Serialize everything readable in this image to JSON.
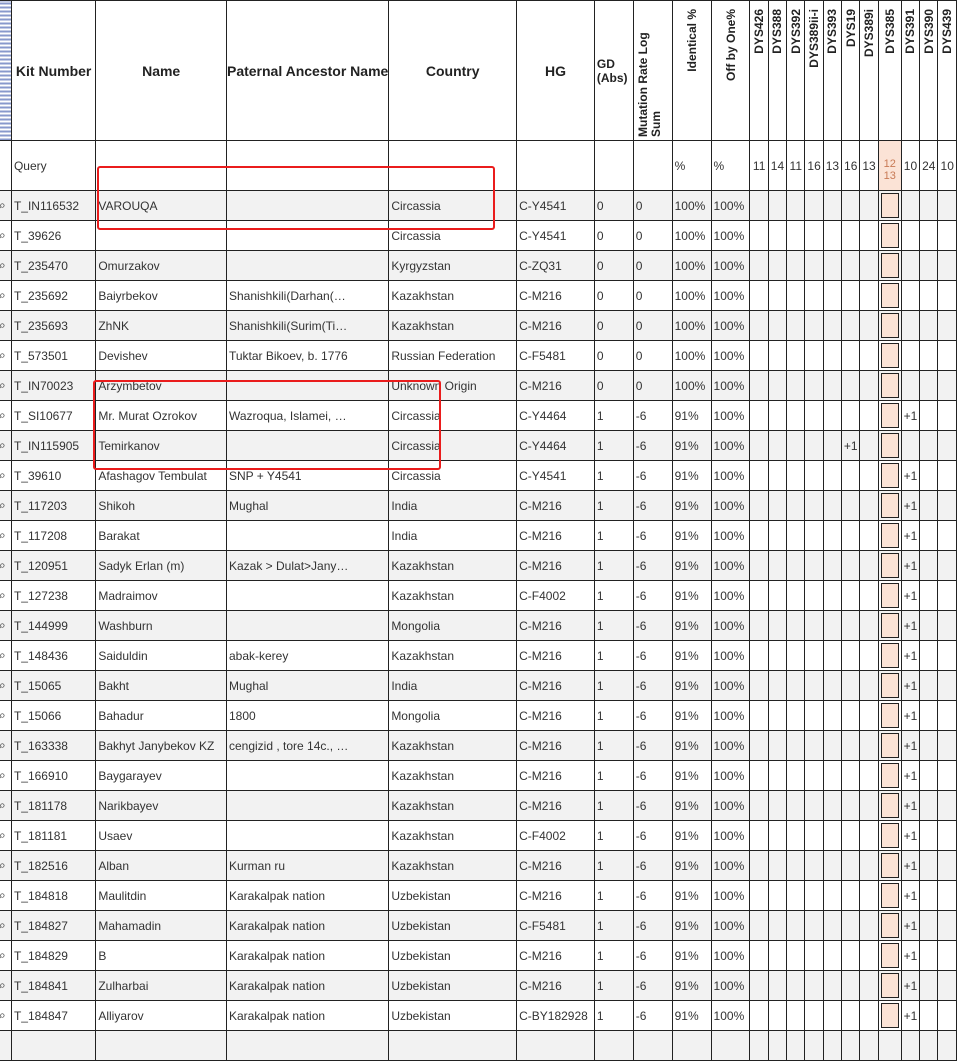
{
  "headers": {
    "kit": "Kit Number",
    "name": "Name",
    "ancestor": "Paternal Ancestor Name",
    "country": "Country",
    "hg": "HG",
    "gd": "GD (Abs)",
    "mut": "Mutation Rate Log Sum",
    "ident": "Identical %",
    "off": "Off by One%",
    "markers": [
      "DYS426",
      "DYS388",
      "DYS392",
      "DYS389ii-i",
      "DYS393",
      "DYS19",
      "DYS389i",
      "DYS385",
      "DYS391",
      "DYS390",
      "DYS439"
    ]
  },
  "query": {
    "kit": "Query",
    "ident": "%",
    "off": "%",
    "markers": [
      "11",
      "14",
      "11",
      "16",
      "13",
      "16",
      "13",
      "12 13",
      "10",
      "24",
      "10"
    ]
  },
  "rows": [
    {
      "kit": "T_IN116532",
      "name": "VAROUQA",
      "anc": "",
      "country": "Circassia",
      "hg": "C-Y4541",
      "gd": "0",
      "mut": "0",
      "id": "100%",
      "off": "100%",
      "m391": "",
      "m19": ""
    },
    {
      "kit": "T_39626",
      "name": "",
      "anc": "",
      "country": "Circassia",
      "hg": "C-Y4541",
      "gd": "0",
      "mut": "0",
      "id": "100%",
      "off": "100%",
      "m391": "",
      "m19": ""
    },
    {
      "kit": "T_235470",
      "name": "Omurzakov",
      "anc": "",
      "country": "Kyrgyzstan",
      "hg": "C-ZQ31",
      "gd": "0",
      "mut": "0",
      "id": "100%",
      "off": "100%",
      "m391": "",
      "m19": ""
    },
    {
      "kit": "T_235692",
      "name": "Baiyrbekov",
      "anc": "Shanishkili(Darhan(…",
      "country": "Kazakhstan",
      "hg": "C-M216",
      "gd": "0",
      "mut": "0",
      "id": "100%",
      "off": "100%",
      "m391": "",
      "m19": ""
    },
    {
      "kit": "T_235693",
      "name": "ZhNK",
      "anc": "Shanishkili(Surim(Ti…",
      "country": "Kazakhstan",
      "hg": "C-M216",
      "gd": "0",
      "mut": "0",
      "id": "100%",
      "off": "100%",
      "m391": "",
      "m19": ""
    },
    {
      "kit": "T_573501",
      "name": "Devishev",
      "anc": "Tuktar Bikoev, b. 1776",
      "country": "Russian Federation",
      "hg": "C-F5481",
      "gd": "0",
      "mut": "0",
      "id": "100%",
      "off": "100%",
      "m391": "",
      "m19": ""
    },
    {
      "kit": "T_IN70023",
      "name": "Arzymbetov",
      "anc": "",
      "country": "Unknown Origin",
      "hg": "C-M216",
      "gd": "0",
      "mut": "0",
      "id": "100%",
      "off": "100%",
      "m391": "",
      "m19": ""
    },
    {
      "kit": "T_SI10677",
      "name": "Mr. Murat Ozrokov",
      "anc": "Wazroqua, Islamei, …",
      "country": "Circassia",
      "hg": "C-Y4464",
      "gd": "1",
      "mut": "-6",
      "id": "91%",
      "off": "100%",
      "m391": "+1",
      "m19": ""
    },
    {
      "kit": "T_IN115905",
      "name": "Temirkanov",
      "anc": "",
      "country": "Circassia",
      "hg": "C-Y4464",
      "gd": "1",
      "mut": "-6",
      "id": "91%",
      "off": "100%",
      "m391": "",
      "m19": "+1"
    },
    {
      "kit": "T_39610",
      "name": "Afashagov Tembulat",
      "anc": "SNP + Y4541",
      "country": "Circassia",
      "hg": "C-Y4541",
      "gd": "1",
      "mut": "-6",
      "id": "91%",
      "off": "100%",
      "m391": "+1",
      "m19": ""
    },
    {
      "kit": "T_117203",
      "name": "Shikoh",
      "anc": "Mughal",
      "country": "India",
      "hg": "C-M216",
      "gd": "1",
      "mut": "-6",
      "id": "91%",
      "off": "100%",
      "m391": "+1",
      "m19": ""
    },
    {
      "kit": "T_117208",
      "name": "Barakat",
      "anc": "",
      "country": "India",
      "hg": "C-M216",
      "gd": "1",
      "mut": "-6",
      "id": "91%",
      "off": "100%",
      "m391": "+1",
      "m19": ""
    },
    {
      "kit": "T_120951",
      "name": "Sadyk Erlan (m)",
      "anc": "Kazak > Dulat>Jany…",
      "country": "Kazakhstan",
      "hg": "C-M216",
      "gd": "1",
      "mut": "-6",
      "id": "91%",
      "off": "100%",
      "m391": "+1",
      "m19": ""
    },
    {
      "kit": "T_127238",
      "name": "Madraimov",
      "anc": "",
      "country": "Kazakhstan",
      "hg": "C-F4002",
      "gd": "1",
      "mut": "-6",
      "id": "91%",
      "off": "100%",
      "m391": "+1",
      "m19": ""
    },
    {
      "kit": "T_144999",
      "name": "Washburn",
      "anc": "",
      "country": "Mongolia",
      "hg": "C-M216",
      "gd": "1",
      "mut": "-6",
      "id": "91%",
      "off": "100%",
      "m391": "+1",
      "m19": ""
    },
    {
      "kit": "T_148436",
      "name": "Saiduldin",
      "anc": "abak-kerey",
      "country": "Kazakhstan",
      "hg": "C-M216",
      "gd": "1",
      "mut": "-6",
      "id": "91%",
      "off": "100%",
      "m391": "+1",
      "m19": ""
    },
    {
      "kit": "T_15065",
      "name": "Bakht",
      "anc": "Mughal",
      "country": "India",
      "hg": "C-M216",
      "gd": "1",
      "mut": "-6",
      "id": "91%",
      "off": "100%",
      "m391": "+1",
      "m19": ""
    },
    {
      "kit": "T_15066",
      "name": "Bahadur",
      "anc": "1800",
      "country": "Mongolia",
      "hg": "C-M216",
      "gd": "1",
      "mut": "-6",
      "id": "91%",
      "off": "100%",
      "m391": "+1",
      "m19": ""
    },
    {
      "kit": "T_163338",
      "name": "Bakhyt Janybekov KZ",
      "anc": "cengizid , tore 14c., …",
      "country": "Kazakhstan",
      "hg": "C-M216",
      "gd": "1",
      "mut": "-6",
      "id": "91%",
      "off": "100%",
      "m391": "+1",
      "m19": ""
    },
    {
      "kit": "T_166910",
      "name": "Baygarayev",
      "anc": "",
      "country": "Kazakhstan",
      "hg": "C-M216",
      "gd": "1",
      "mut": "-6",
      "id": "91%",
      "off": "100%",
      "m391": "+1",
      "m19": ""
    },
    {
      "kit": "T_181178",
      "name": "Narikbayev",
      "anc": "",
      "country": "Kazakhstan",
      "hg": "C-M216",
      "gd": "1",
      "mut": "-6",
      "id": "91%",
      "off": "100%",
      "m391": "+1",
      "m19": ""
    },
    {
      "kit": "T_181181",
      "name": "Usaev",
      "anc": "",
      "country": "Kazakhstan",
      "hg": "C-F4002",
      "gd": "1",
      "mut": "-6",
      "id": "91%",
      "off": "100%",
      "m391": "+1",
      "m19": ""
    },
    {
      "kit": "T_182516",
      "name": "Alban",
      "anc": "Kurman ru",
      "country": "Kazakhstan",
      "hg": "C-M216",
      "gd": "1",
      "mut": "-6",
      "id": "91%",
      "off": "100%",
      "m391": "+1",
      "m19": ""
    },
    {
      "kit": "T_184818",
      "name": "Maulitdin",
      "anc": "Karakalpak nation",
      "country": "Uzbekistan",
      "hg": "C-M216",
      "gd": "1",
      "mut": "-6",
      "id": "91%",
      "off": "100%",
      "m391": "+1",
      "m19": ""
    },
    {
      "kit": "T_184827",
      "name": "Mahamadin",
      "anc": "Karakalpak nation",
      "country": "Uzbekistan",
      "hg": "C-F5481",
      "gd": "1",
      "mut": "-6",
      "id": "91%",
      "off": "100%",
      "m391": "+1",
      "m19": ""
    },
    {
      "kit": "T_184829",
      "name": "B",
      "anc": "Karakalpak nation",
      "country": "Uzbekistan",
      "hg": "C-M216",
      "gd": "1",
      "mut": "-6",
      "id": "91%",
      "off": "100%",
      "m391": "+1",
      "m19": ""
    },
    {
      "kit": "T_184841",
      "name": "Zulharbai",
      "anc": "Karakalpak nation",
      "country": "Uzbekistan",
      "hg": "C-M216",
      "gd": "1",
      "mut": "-6",
      "id": "91%",
      "off": "100%",
      "m391": "+1",
      "m19": ""
    },
    {
      "kit": "T_184847",
      "name": "Alliyarov",
      "anc": "Karakalpak nation",
      "country": "Uzbekistan",
      "hg": "C-BY182928",
      "gd": "1",
      "mut": "-6",
      "id": "91%",
      "off": "100%",
      "m391": "+1",
      "m19": ""
    },
    {
      "kit": "",
      "name": "",
      "anc": "",
      "country": "",
      "hg": "",
      "gd": "",
      "mut": "",
      "id": "",
      "off": "",
      "m391": "",
      "m19": ""
    }
  ],
  "colors": {
    "highlight": "#ea1c1c",
    "dys385_fill": "#fbe3d6",
    "dys385_query_text": "#c87a55"
  }
}
